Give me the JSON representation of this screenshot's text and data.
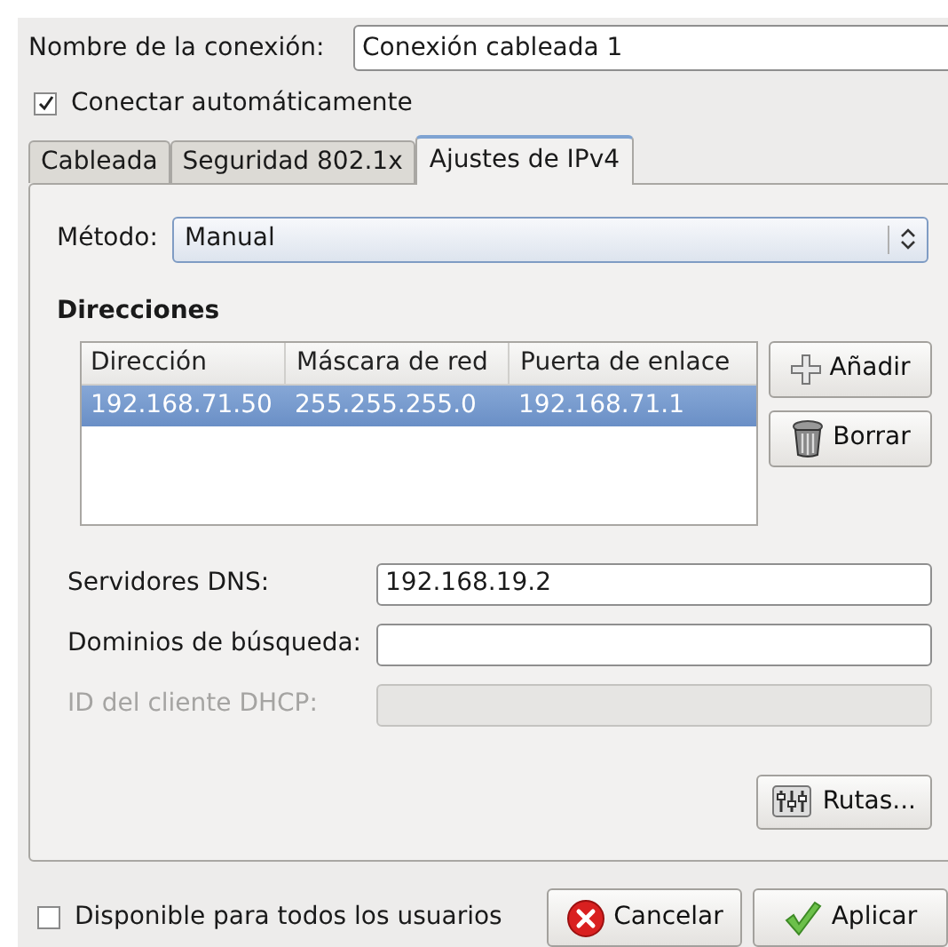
{
  "connection_name": {
    "label": "Nombre de la conexión:",
    "value": "Conexión cableada 1"
  },
  "auto_connect": {
    "label": "Conectar automáticamente",
    "checked": true
  },
  "tabs": [
    {
      "label": "Cableada",
      "selected": false
    },
    {
      "label": "Seguridad 802.1x",
      "selected": false
    },
    {
      "label": "Ajustes de IPv4",
      "selected": true
    }
  ],
  "method": {
    "label": "Método:",
    "value": "Manual"
  },
  "addresses": {
    "title": "Direcciones",
    "columns": [
      "Dirección",
      "Máscara de red",
      "Puerta de enlace"
    ],
    "rows": [
      {
        "cells": [
          "192.168.71.50",
          "255.255.255.0",
          "192.168.71.1"
        ],
        "selected": true
      }
    ],
    "buttons": [
      {
        "label": "Añadir",
        "kind": "add"
      },
      {
        "label": "Borrar",
        "kind": "delete"
      }
    ]
  },
  "fields": [
    {
      "label": "Servidores DNS:",
      "value": "192.168.19.2",
      "disabled": false
    },
    {
      "label": "Dominios de búsqueda:",
      "disabled": false
    },
    {
      "label": "ID del cliente DHCP:",
      "disabled": true
    }
  ],
  "routes_button": "Rutas...",
  "all_users": {
    "label": "Disponible para todos los usuarios",
    "checked": false
  },
  "buttons": [
    {
      "label": "Cancelar",
      "kind": "cancel"
    },
    {
      "label": "Aplicar",
      "kind": "apply"
    }
  ]
}
